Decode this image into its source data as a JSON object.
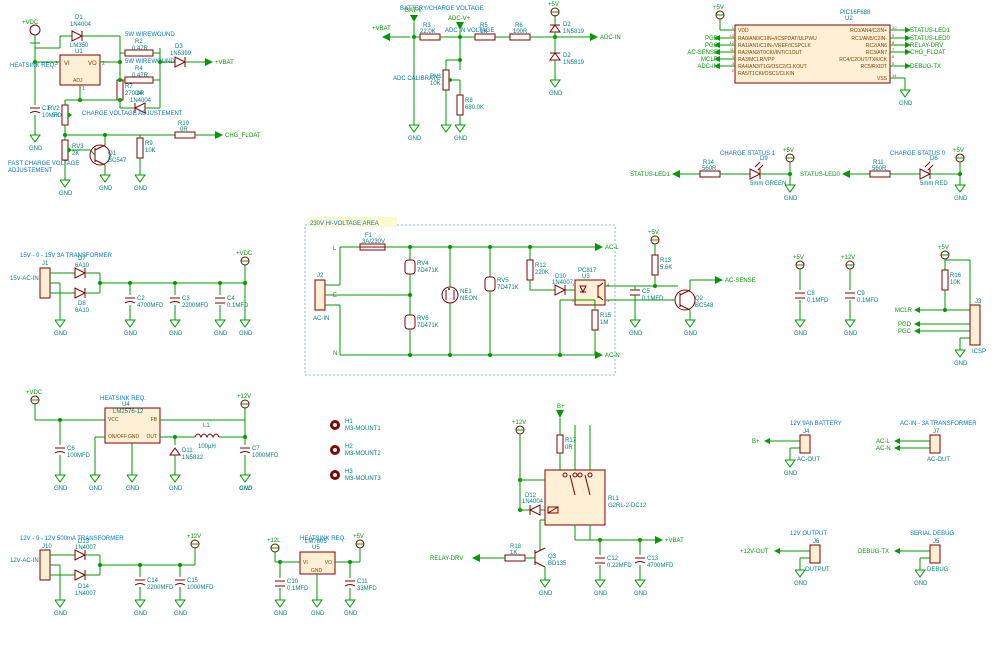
{
  "voltage_regulator": {
    "title": "+VDC",
    "d1": {
      "ref": "D1",
      "val": "1N4004"
    },
    "r2": {
      "ref": "R2",
      "val": "0.47R",
      "note": "5W WIREWOUND"
    },
    "r4": {
      "ref": "R4",
      "val": "0.47R",
      "note": "5W WIREWOUND"
    },
    "d3": {
      "ref": "D3",
      "val": "1N5399"
    },
    "u1": {
      "ref": "U1",
      "val": "LM350",
      "pins": [
        "VI",
        "ADJ",
        "VO"
      ]
    },
    "heatsink": "HEATSINK REQ.",
    "c1": {
      "ref": "C1",
      "val": "10MFD"
    },
    "r7": {
      "ref": "R7",
      "val": "270.0R"
    },
    "d4": {
      "ref": "D4",
      "val": "1N4004"
    },
    "rv2": {
      "ref": "RV2",
      "val": "5K",
      "note": "CHARGE VOLTAGE ADJUSTEMENT"
    },
    "rv3": {
      "ref": "RV3",
      "val": "2K",
      "note": "FAST CHARGE VOLTAGE ADJUSTEMENT"
    },
    "q1": {
      "ref": "Q1",
      "val": "BC547"
    },
    "r9": {
      "ref": "R9",
      "val": "10K"
    },
    "r10": {
      "ref": "R10",
      "val": "0R"
    },
    "out_vbat": "+VBAT",
    "chg_float": "CHG_FLOAT",
    "gnd": "GND"
  },
  "adc_block": {
    "title": "BATTERY/CHARGE VOLTAGE",
    "in_title": "ADC IN VOLTAGE",
    "calibrate": "ADC CALIBRATE",
    "vbat": "+VBAT",
    "batv": "BAT-V",
    "adcv": "ADC-V+",
    "adcin": "ADC-IN",
    "r3": {
      "ref": "R3",
      "val": "22.0K"
    },
    "r5": {
      "ref": "R5",
      "val": "1K"
    },
    "r6": {
      "ref": "R6",
      "val": "100R"
    },
    "d2l": {
      "ref": "D2",
      "val": "1N5819"
    },
    "d2r": {
      "ref": "D2",
      "val": "1N5819"
    },
    "rv1": {
      "ref": "RV1",
      "val": "10K"
    },
    "r8": {
      "ref": "R8",
      "val": "680.0K"
    },
    "gnd": "GND",
    "v5": "+5V"
  },
  "mcu": {
    "ref": "U2",
    "val": "PIC16F688",
    "v5": "+5V",
    "gnd": "GND",
    "left_pins": [
      {
        "num": "1",
        "name": "VDD"
      },
      {
        "num": "13",
        "name": "RA0/AN0/C1IN+/ICSPDAT/ULPWU"
      },
      {
        "num": "12",
        "name": "RA1/AN1/C1IN-/VREF/ICSPCLK"
      },
      {
        "num": "11",
        "name": "RA2/AN2/T0CKI/INT/C1OUT"
      },
      {
        "num": "4",
        "name": "RA3/MCLR/VPP"
      },
      {
        "num": "3",
        "name": "RA4/AN3/T1G/OSC2/CLKOUT"
      },
      {
        "num": "2",
        "name": "RA5/T1CKI/OSC1/CLKIN"
      }
    ],
    "right_pins": [
      {
        "num": "10",
        "name": "RC0/AN4/C2IN+"
      },
      {
        "num": "9",
        "name": "RC1/AN5/C2IN-"
      },
      {
        "num": "8",
        "name": "RC2/AN6"
      },
      {
        "num": "7",
        "name": "RC3/AN7"
      },
      {
        "num": "6",
        "name": "RC4/C2OUT/TXK/CK"
      },
      {
        "num": "5",
        "name": "RC5/RXIDT"
      },
      {
        "num": "14",
        "name": "VSS"
      }
    ],
    "left_nets": [
      "",
      "PGD",
      "PGC",
      "AC-SENSE",
      "MCLR",
      "ADC-IN",
      ""
    ],
    "right_nets": [
      "STATUS-LED1",
      "STATUS-LED0",
      "RELAY-DRV",
      "CHG_FLOAT",
      "",
      "DEBUG-TX",
      ""
    ]
  },
  "status_leds": {
    "led1": {
      "title": "CHARGE STATUS 1",
      "net": "STATUS-LED1",
      "r": {
        "ref": "R14",
        "val": "560R"
      },
      "d": {
        "ref": "D9",
        "val": "5mm GREEN"
      },
      "v5": "+5V",
      "gnd": "GND"
    },
    "led0": {
      "title": "CHARGE STATUS 0",
      "net": "STATUS-LED0",
      "r": {
        "ref": "R11",
        "val": "560R"
      },
      "d": {
        "ref": "D6",
        "val": "5mm RED"
      },
      "v5": "+5V",
      "gnd": "GND"
    }
  },
  "transformer15": {
    "title": "15V - 0 - 15V 3A TRANSFORMER",
    "j1": {
      "ref": "J1",
      "val": "15V-AC-IN"
    },
    "d7": {
      "ref": "D7",
      "val": "6A10"
    },
    "d8": {
      "ref": "D8",
      "val": "6A10"
    },
    "c2": {
      "ref": "C2",
      "val": "4700MFD"
    },
    "c3": {
      "ref": "C3",
      "val": "2200MFD"
    },
    "c4": {
      "ref": "C4",
      "val": "0.1MFD"
    },
    "vdc": "+VDC",
    "gnd": "GND"
  },
  "hv_area": {
    "title": "230V HI-VOLTAGE AREA",
    "j2": {
      "ref": "J2",
      "val": "AC-IN"
    },
    "f1": {
      "ref": "F1",
      "val": "3A/230V"
    },
    "rv4": {
      "ref": "RV4",
      "val": "7D471K"
    },
    "rv6": {
      "ref": "RV6",
      "val": "7D471K"
    },
    "ne1": {
      "ref": "NE1",
      "val": "NEON"
    },
    "rv5": {
      "ref": "RV5",
      "val": "7D471K"
    },
    "r12": {
      "ref": "R12",
      "val": "220K"
    },
    "d10": {
      "ref": "D10",
      "val": "1N4007"
    },
    "u3": {
      "ref": "U3",
      "val": "PC817"
    },
    "r15": {
      "ref": "R15",
      "val": "1M"
    },
    "acl": "AC-L",
    "acn": "AC-N",
    "l": "L",
    "e": "E",
    "n": "N"
  },
  "ac_sense": {
    "v5": "+5V",
    "r13": {
      "ref": "R13",
      "val": "5.6K"
    },
    "c5": {
      "ref": "C5",
      "val": "0.1MFD"
    },
    "q2": {
      "ref": "Q2",
      "val": "BC548"
    },
    "net": "AC-SENSE",
    "gnd": "GND"
  },
  "decouple": {
    "c8": {
      "ref": "C8",
      "val": "0.1MFD"
    },
    "c9": {
      "ref": "C9",
      "val": "0.1MFD"
    },
    "v5": "+5V",
    "v12": "+12V",
    "gnd": "GND"
  },
  "icsp": {
    "j3": {
      "ref": "J3",
      "val": "ICSP"
    },
    "r16": {
      "ref": "R16",
      "val": "10K"
    },
    "v5": "+5V",
    "mclr": "MCLR",
    "pgd": "PGD",
    "pgc": "PGC",
    "gnd": "GND"
  },
  "buck_12v": {
    "title": "HEATSINK REQ.",
    "u4": {
      "ref": "U4",
      "val": "LM2576-12"
    },
    "pins": [
      "VCC",
      "FB",
      "ON/OFF",
      "GND",
      "OUT"
    ],
    "c6": {
      "ref": "C6",
      "val": "100MFD"
    },
    "d11": {
      "ref": "D11",
      "val": "1N5822"
    },
    "l1": {
      "ref": "L1",
      "val": "100µH"
    },
    "c7": {
      "ref": "C7",
      "val": "1000MFD"
    },
    "vdc": "+VDC",
    "v12": "+12V",
    "gnd": "GND"
  },
  "mounts": {
    "h1": {
      "ref": "H1",
      "val": "M3-MOUNT1"
    },
    "h2": {
      "ref": "H2",
      "val": "M3-MOUNT2"
    },
    "h3": {
      "ref": "H3",
      "val": "M3-MOUNT3"
    }
  },
  "relay_block": {
    "bplus": "B+",
    "v12": "+12V",
    "r17": {
      "ref": "R17",
      "val": "0R"
    },
    "d12": {
      "ref": "D12",
      "val": "1N4004"
    },
    "rl1": {
      "ref": "RL1",
      "val": "G2RL-2-DC12"
    },
    "r18": {
      "ref": "R18",
      "val": "1K"
    },
    "q3": {
      "ref": "Q3",
      "val": "BD135"
    },
    "c12": {
      "ref": "C12",
      "val": "0.22MFD"
    },
    "c13": {
      "ref": "C13",
      "val": "4700MFD"
    },
    "relay_drv": "RELAY-DRV",
    "vbat": "+VBAT",
    "gnd": "GND"
  },
  "transformer12": {
    "title": "12V - 0 - 12V 500mA TRANSFORMER",
    "j10": {
      "ref": "J10",
      "val": "12V-AC-IN"
    },
    "d13": {
      "ref": "D13",
      "val": "1N4007"
    },
    "d14": {
      "ref": "D14",
      "val": "1N4007"
    },
    "c14": {
      "ref": "C14",
      "val": "2200MFD"
    },
    "c15": {
      "ref": "C15",
      "val": "1000MFD"
    },
    "v12": "+12V",
    "gnd": "GND"
  },
  "reg5v": {
    "title": "HEATSINK REQ.",
    "u5": {
      "ref": "U5",
      "val": "LM7805",
      "pins": [
        "VI",
        "GND",
        "VO"
      ]
    },
    "c10": {
      "ref": "C10",
      "val": "0.1MFD"
    },
    "c11": {
      "ref": "C11",
      "val": "33MFD"
    },
    "v12l": "+12L",
    "v5": "+5V",
    "gnd": "GND"
  },
  "battery_conn": {
    "title": "12V 9Ah BATTERY",
    "j4": {
      "ref": "J4",
      "val": "AC-OUT"
    },
    "bplus": "B+",
    "gnd": "GND"
  },
  "ac_transformer": {
    "title": "AC-IN - 3A TRANSFORMER",
    "j7": {
      "ref": "J7",
      "val": "AC-OUT"
    },
    "acl": "AC-L",
    "acn": "AC-N"
  },
  "out12v": {
    "title": "12V OUTPUT",
    "j6": {
      "ref": "J6",
      "val": "OUTPUT"
    },
    "net": "+12V-OUT",
    "gnd": "GND"
  },
  "serial": {
    "title": "SERIAL DEBUG",
    "j5": {
      "ref": "J5",
      "val": "DEBUG"
    },
    "net": "DEBUG-TX",
    "gnd": "GND"
  }
}
